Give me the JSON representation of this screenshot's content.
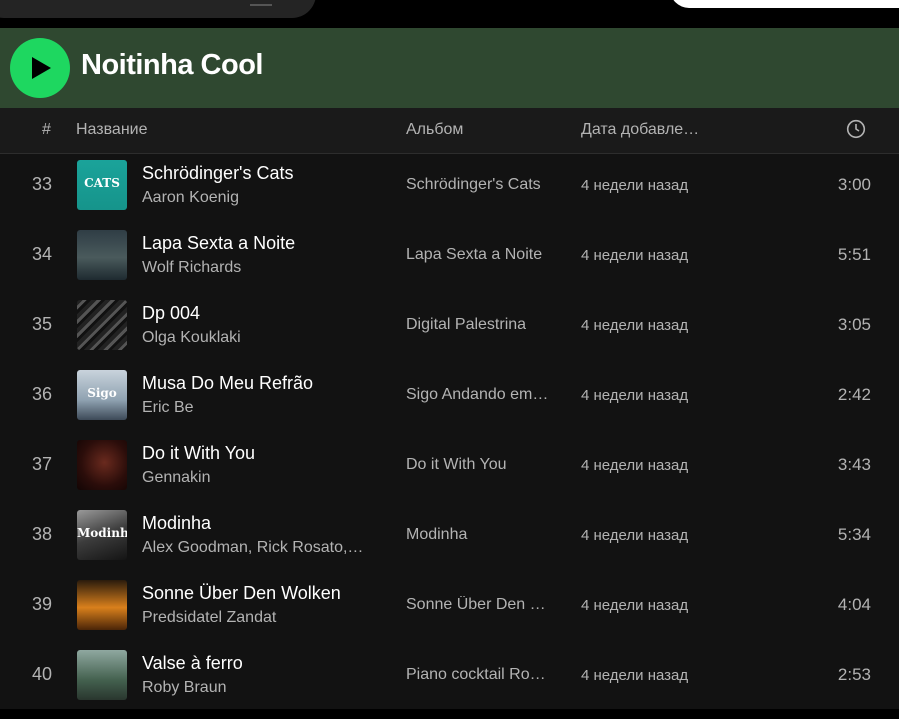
{
  "playlist": {
    "title": "Noitinha Cool"
  },
  "columns": {
    "number": "#",
    "title": "Название",
    "album": "Альбом",
    "date_added": "Дата добавле…",
    "duration_icon": "clock-icon"
  },
  "colors": {
    "accent": "#1ed760",
    "header_bg": "#2f4830",
    "background": "#121212"
  },
  "tracks": [
    {
      "num": "33",
      "title": "Schrödinger's Cats",
      "artist": "Aaron Koenig",
      "album": "Schrödinger's Cats",
      "added": "4 недели назад",
      "duration": "3:00",
      "cover_text": "CATS"
    },
    {
      "num": "34",
      "title": "Lapa Sexta a Noite",
      "artist": "Wolf Richards",
      "album": "Lapa Sexta a Noite",
      "added": "4 недели назад",
      "duration": "5:51",
      "cover_text": ""
    },
    {
      "num": "35",
      "title": "Dp 004",
      "artist": "Olga Kouklaki",
      "album": "Digital Palestrina",
      "added": "4 недели назад",
      "duration": "3:05",
      "cover_text": ""
    },
    {
      "num": "36",
      "title": "Musa Do Meu Refrão",
      "artist": "Eric Be",
      "album": "Sigo Andando em…",
      "added": "4 недели назад",
      "duration": "2:42",
      "cover_text": "Sigo"
    },
    {
      "num": "37",
      "title": "Do it With You",
      "artist": "Gennakin",
      "album": "Do it With You",
      "added": "4 недели назад",
      "duration": "3:43",
      "cover_text": ""
    },
    {
      "num": "38",
      "title": "Modinha",
      "artist": "Alex Goodman, Rick Rosato,…",
      "album": "Modinha",
      "added": "4 недели назад",
      "duration": "5:34",
      "cover_text": "Modinha"
    },
    {
      "num": "39",
      "title": "Sonne Über Den Wolken",
      "artist": "Predsidatel Zandat",
      "album": "Sonne Über Den …",
      "added": "4 недели назад",
      "duration": "4:04",
      "cover_text": ""
    },
    {
      "num": "40",
      "title": "Valse à ferro",
      "artist": "Roby Braun",
      "album": "Piano cocktail Ro…",
      "added": "4 недели назад",
      "duration": "2:53",
      "cover_text": ""
    }
  ]
}
